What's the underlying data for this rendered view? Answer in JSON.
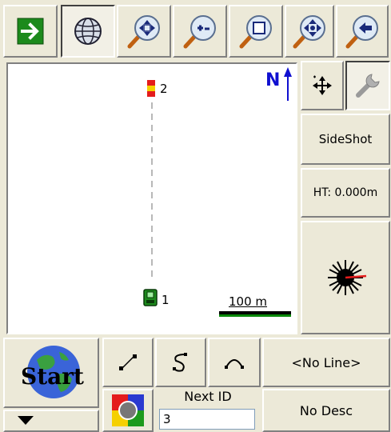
{
  "toolbar": {
    "items": [
      {
        "name": "go-icon"
      },
      {
        "name": "globe-icon"
      },
      {
        "name": "zoom-extents-icon"
      },
      {
        "name": "zoom-in-icon"
      },
      {
        "name": "zoom-window-icon"
      },
      {
        "name": "pan-icon"
      },
      {
        "name": "zoom-previous-icon"
      }
    ]
  },
  "map": {
    "north_label": "N",
    "points": [
      {
        "id": "2",
        "type": "target-rod"
      },
      {
        "id": "1",
        "type": "instrument"
      }
    ],
    "scale_label": "100 m"
  },
  "side_panel": {
    "pan_icon": "move-cross-icon",
    "settings_icon": "wrench-icon",
    "sideshot_label": "SideShot",
    "ht_label": "HT: 0.000m",
    "measure_icon": "laser-burst-icon"
  },
  "bottom": {
    "start_label": "Start",
    "line_icons": [
      "line-segment-icon",
      "spline-icon",
      "arc-icon"
    ],
    "line_select_label": "<No Line>",
    "next_id_label": "Next ID",
    "next_id_value": "3",
    "desc_label": "No Desc",
    "color_icon": "color-picker-icon",
    "dropdown_icon": "dropdown-arrow-icon"
  },
  "colors": {
    "accent_green": "#1c8a1c",
    "north_blue": "#1010d0",
    "target_red": "#e41c1c",
    "target_yellow": "#f5d000"
  }
}
